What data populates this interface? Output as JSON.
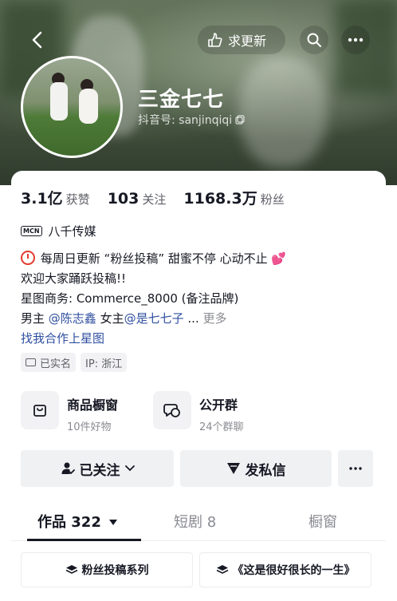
{
  "header": {
    "update_label": "求更新"
  },
  "profile": {
    "nickname": "三金七七",
    "douyin_id_label": "抖音号: sanjinqiqi"
  },
  "stats": [
    {
      "value": "3.1亿",
      "label": "获赞"
    },
    {
      "value": "103",
      "label": "关注"
    },
    {
      "value": "1168.3万",
      "label": "粉丝"
    }
  ],
  "mcn": {
    "badge": "MCN",
    "name": "八千传媒"
  },
  "bio": {
    "line1": "每周日更新 “粉丝投稿” 甜蜜不停 心动不止",
    "line2": "欢迎大家踊跃投稿!!",
    "line3": "星图商务: Commerce_8000 (备注品牌)",
    "line4_prefix": "男主",
    "male_lead": "@陈志鑫",
    "line4_mid": "女主",
    "female_lead": "@是七七子",
    "ellipsis": "...",
    "more": "更多",
    "cooperate_link": "找我合作上星图"
  },
  "tags": {
    "verified": "已实名",
    "ip": "IP: 浙江"
  },
  "cards": {
    "shop_title": "商品橱窗",
    "shop_sub": "10件好物",
    "group_title": "公开群",
    "group_sub": "24个群聊"
  },
  "actions": {
    "following": "已关注",
    "message": "发私信"
  },
  "tabs": {
    "works": "作品 322",
    "shorts": "短剧 8",
    "showcase": "橱窗"
  },
  "collections": {
    "fan_series": "粉丝投稿系列",
    "long_life": "《这是很好很长的一生》"
  },
  "colors": {
    "mention": "#2f4fa0",
    "text": "#161823",
    "muted": "#8a8b91"
  }
}
